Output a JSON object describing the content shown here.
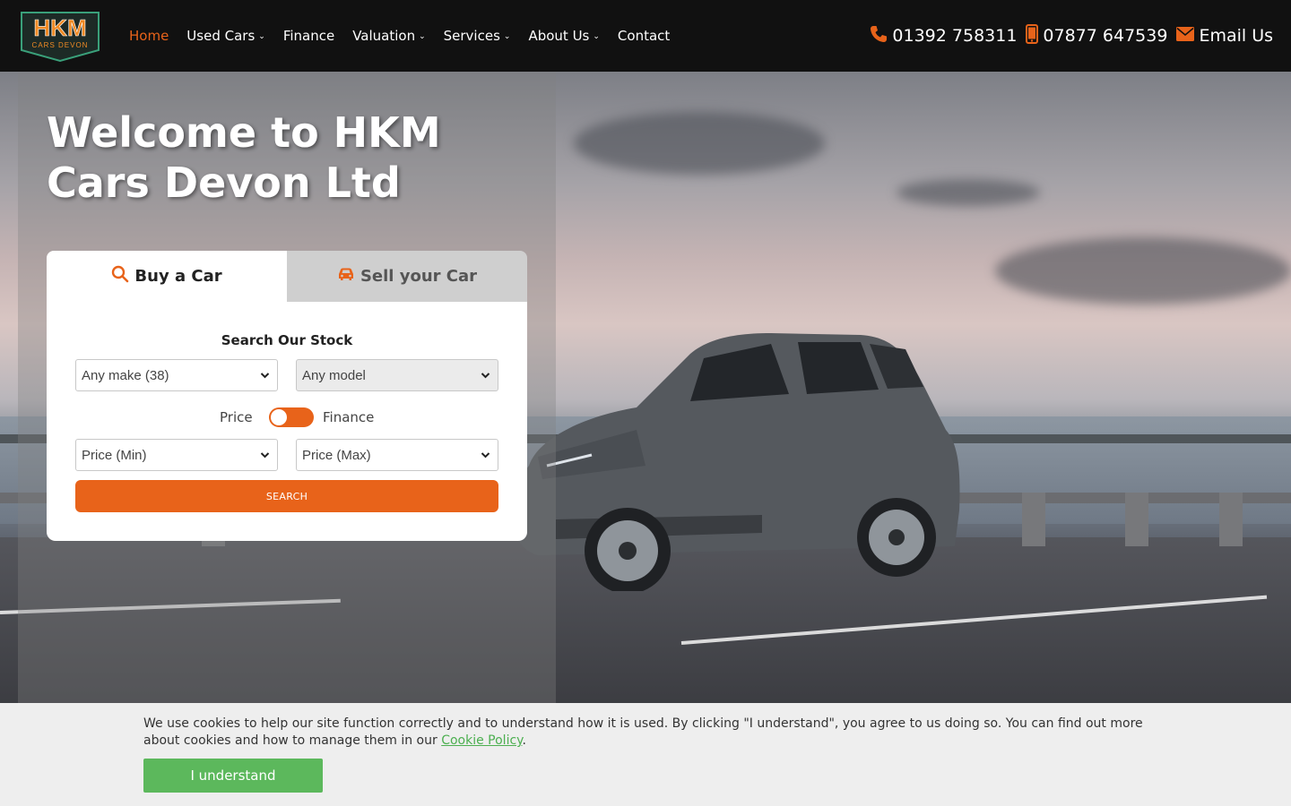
{
  "brand": {
    "logo_main": "HKM",
    "logo_sub": "CARS DEVON",
    "accent_color": "#e8631a",
    "header_bg": "#111111"
  },
  "nav": {
    "items": [
      {
        "label": "Home",
        "active": true,
        "dropdown": false
      },
      {
        "label": "Used Cars",
        "active": false,
        "dropdown": true
      },
      {
        "label": "Finance",
        "active": false,
        "dropdown": false
      },
      {
        "label": "Valuation",
        "active": false,
        "dropdown": true
      },
      {
        "label": "Services",
        "active": false,
        "dropdown": true
      },
      {
        "label": "About Us",
        "active": false,
        "dropdown": true
      },
      {
        "label": "Contact",
        "active": false,
        "dropdown": false
      }
    ]
  },
  "contacts": {
    "phone": {
      "label": "01392 758311",
      "icon": "phone-icon"
    },
    "mobile": {
      "label": "07877 647539",
      "icon": "mobile-icon"
    },
    "email": {
      "label": "Email Us",
      "icon": "envelope-icon"
    }
  },
  "hero": {
    "title": "Welcome to HKM Cars Devon Ltd"
  },
  "search": {
    "tabs": {
      "buy": {
        "label": "Buy a Car",
        "icon": "search-icon",
        "active": true
      },
      "sell": {
        "label": "Sell your Car",
        "icon": "car-icon",
        "active": false
      }
    },
    "title": "Search Our Stock",
    "make": {
      "value": "Any make (38)"
    },
    "model": {
      "value": "Any model",
      "disabled": true
    },
    "toggle": {
      "left_label": "Price",
      "right_label": "Finance"
    },
    "price_min": {
      "value": "Price (Min)"
    },
    "price_max": {
      "value": "Price (Max)"
    },
    "button": "SEARCH"
  },
  "cookie": {
    "text": "We use cookies to help our site function correctly and to understand how it is used. By clicking \"I understand\", you agree to us doing so. You can find out more about cookies and how to manage them in our ",
    "link": "Cookie Policy",
    "end": ".",
    "button": "I understand",
    "button_color": "#5cb85c"
  }
}
